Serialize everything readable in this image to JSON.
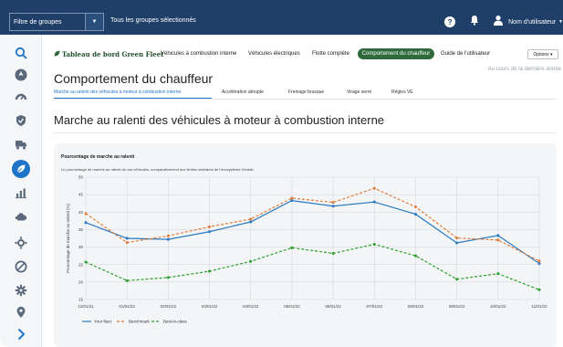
{
  "topbar": {
    "group_filter": "Filtre de groupes",
    "all_groups": "Tous les groupes sélectionnés",
    "help_symbol": "?",
    "user_name": "Nom d'utilisateur",
    "icons": [
      "help-icon",
      "bell-icon",
      "user-icon",
      "chevron-down-icon"
    ]
  },
  "sidebar": {
    "items": [
      {
        "name": "search",
        "icon": "search-icon"
      },
      {
        "name": "getting-started",
        "icon": "rocket-icon"
      },
      {
        "name": "productivity",
        "icon": "gauge-icon"
      },
      {
        "name": "compliance",
        "icon": "shield-icon"
      },
      {
        "name": "maintenance",
        "icon": "truck-icon"
      },
      {
        "name": "sustainability",
        "icon": "leaf-icon",
        "active": true
      },
      {
        "name": "reports",
        "icon": "chart-icon"
      },
      {
        "name": "engine",
        "icon": "engine-icon"
      },
      {
        "name": "rules",
        "icon": "rules-icon"
      },
      {
        "name": "zones",
        "icon": "zone-icon"
      },
      {
        "name": "settings",
        "icon": "settings-icon"
      },
      {
        "name": "map",
        "icon": "map-pin-icon"
      },
      {
        "name": "expand",
        "icon": "chevron-right-icon"
      }
    ]
  },
  "header": {
    "brand": "Tableau de bord Green Fleet",
    "menu": [
      "Véhicules à combustion interne",
      "Véhicules électriques",
      "Flotte complète",
      "Comportement du chauffeur",
      "Guide de l'utilisateur"
    ],
    "active_menu": "Comportement du chauffeur",
    "options_label": "Options",
    "period": "Au cours de la dernière année",
    "page_title": "Comportement du chauffeur"
  },
  "tabs": [
    "Marche au ralenti des véhicules à moteur à combustion interne",
    "Accélération abrupte",
    "Freinage brusque",
    "Virage serré",
    "Règles VE"
  ],
  "section": {
    "title": "Marche au ralenti des véhicules à moteur à combustion interne"
  },
  "card": {
    "title": "Pourcentage de marche au ralenti",
    "description": "Le pourcentage de marche au ralenti de vos véhicules, comparativement aux limites similaires de l'écosystème Geotab."
  },
  "colors": {
    "topbar": "#1f3f68",
    "accent": "#1e74c9",
    "active_menu": "#2f6b3a",
    "your_fleet": "#2a78bf",
    "benchmark": "#e07b39",
    "best_in_class": "#2ca02c"
  },
  "chart_data": {
    "type": "line",
    "title": "",
    "xlabel": "",
    "ylabel": "Pourcentage de marche au ralenti (%)",
    "ylim": [
      15,
      50
    ],
    "yticks": [
      15,
      20,
      25,
      30,
      35,
      40,
      45,
      50
    ],
    "grid": true,
    "legend": "bottom-left",
    "x": [
      "12/01/21",
      "01/01/22",
      "02/01/22",
      "03/01/22",
      "04/01/22",
      "05/01/22",
      "06/01/22",
      "07/01/22",
      "08/01/22",
      "09/01/22",
      "10/01/22",
      "11/01/22"
    ],
    "series": [
      {
        "name": "Your fleet",
        "color": "#2a78bf",
        "dash": "solid",
        "values": [
          37,
          32.5,
          32.2,
          34.4,
          37.2,
          43.3,
          41.7,
          42.9,
          39.4,
          31.2,
          33.3,
          25.3
        ]
      },
      {
        "name": "Benchmark",
        "color": "#e07b39",
        "dash": "dashed",
        "values": [
          39.6,
          31.3,
          33.2,
          35.8,
          38,
          44,
          42.8,
          46.8,
          41.5,
          32.6,
          32,
          26
        ]
      },
      {
        "name": "Best-in-class",
        "color": "#2ca02c",
        "dash": "dashed",
        "values": [
          25.7,
          20.4,
          21.3,
          23.1,
          25.9,
          29.8,
          28.2,
          30.8,
          27.5,
          20.8,
          22.4,
          17.8
        ]
      }
    ]
  }
}
